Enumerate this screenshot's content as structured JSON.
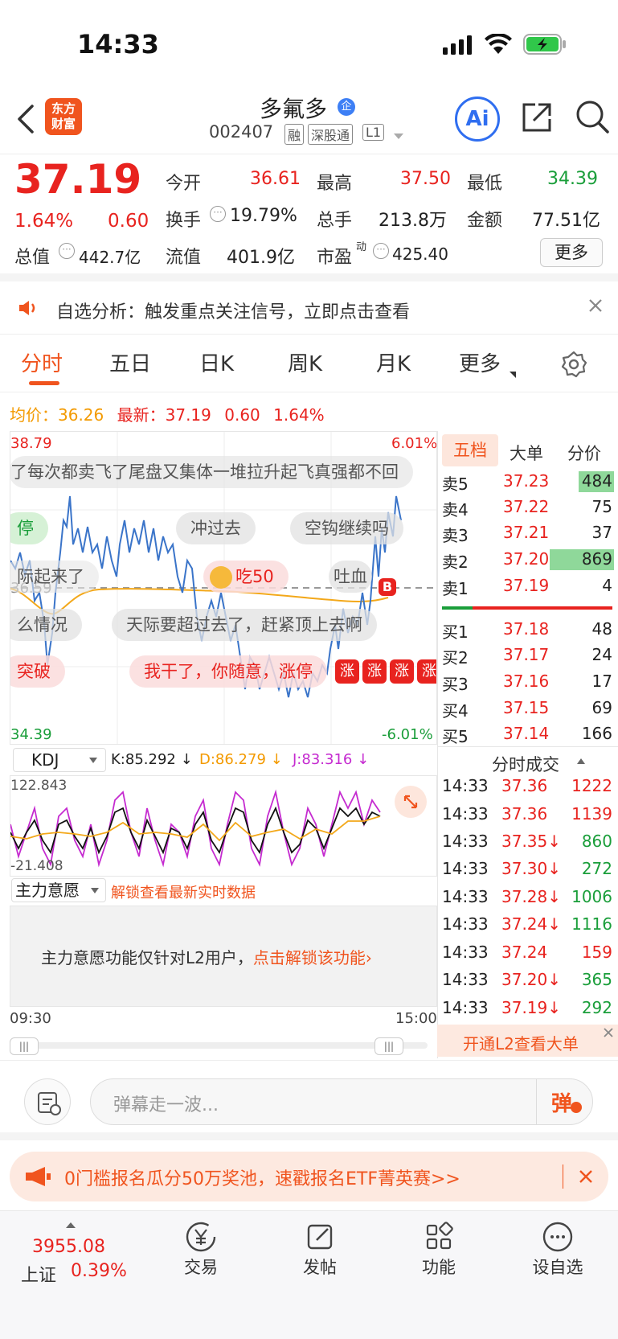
{
  "status_bar": {
    "time": "14:33"
  },
  "header": {
    "app_logo": "东方财富",
    "stock_name": "多氟多",
    "enterprise_badge": "企",
    "stock_code": "002407",
    "tags": [
      "融",
      "深股通",
      "L1"
    ],
    "ai_label": "Ai"
  },
  "quote": {
    "price": "37.19",
    "change_pct": "1.64%",
    "change": "0.60",
    "open_label": "今开",
    "open": "36.61",
    "high_label": "最高",
    "high": "37.50",
    "low_label": "最低",
    "low": "34.39",
    "turnover_label": "换手",
    "turnover": "19.79%",
    "volume_label": "总手",
    "volume": "213.8万",
    "amount_label": "金额",
    "amount": "77.51亿",
    "mktcap_label": "总值",
    "mktcap": "442.7亿",
    "float_label": "流值",
    "float": "401.9亿",
    "pe_label": "市盈",
    "pe_sup": "动",
    "pe": "425.40",
    "more_label": "更多"
  },
  "notice": {
    "text": "自选分析：触发重点关注信号，立即点击查看"
  },
  "chart_tabs": [
    "分时",
    "五日",
    "日K",
    "周K",
    "月K",
    "更多"
  ],
  "avg_line": {
    "avg_label": "均价：",
    "avg": "36.26",
    "latest_label": "最新：",
    "latest": "37.19",
    "latest_change": "0.60",
    "latest_pct": "1.64%"
  },
  "chart_axes": {
    "top_price": "38.79",
    "top_pct": "6.01%",
    "mid_price": "36.59",
    "bottom_price": "34.39",
    "bottom_pct": "-6.01%",
    "time_start": "09:30",
    "time_end": "15:00"
  },
  "danmu": {
    "d1": "了每次都卖飞了尾盘又集体一堆拉升起飞真强都不回",
    "d2": "停",
    "d3": "冲过去",
    "d4": "空钩继续吗",
    "d5": "际起来了",
    "d6": "吃50",
    "d7": "吐血",
    "d8": "么情况",
    "d9": "天际要超过去了，赶紧顶上去啊",
    "d10": "突破",
    "d11": "我干了，你随意，涨停",
    "d12": "涨",
    "b_marker": "B"
  },
  "kdj": {
    "label": "KDJ",
    "k": "K:85.292 ↓",
    "d": "D:86.279 ↓",
    "j": "J:83.316 ↓",
    "max": "122.843",
    "min": "-21.408"
  },
  "main_force": {
    "label": "主力意愿",
    "unlock_link": "解锁查看最新实时数据",
    "info_text": "主力意愿功能仅针对L2用户，",
    "info_link": "点击解锁该功能›"
  },
  "orderbook": {
    "tabs": [
      "五档",
      "大单",
      "分价"
    ],
    "asks": [
      {
        "label": "卖5",
        "price": "37.23",
        "vol": "484"
      },
      {
        "label": "卖4",
        "price": "37.22",
        "vol": "75"
      },
      {
        "label": "卖3",
        "price": "37.21",
        "vol": "37"
      },
      {
        "label": "卖2",
        "price": "37.20",
        "vol": "869"
      },
      {
        "label": "卖1",
        "price": "37.19",
        "vol": "4"
      }
    ],
    "bids": [
      {
        "label": "买1",
        "price": "37.18",
        "vol": "48"
      },
      {
        "label": "买2",
        "price": "37.17",
        "vol": "24"
      },
      {
        "label": "买3",
        "price": "37.16",
        "vol": "17"
      },
      {
        "label": "买4",
        "price": "37.15",
        "vol": "69"
      },
      {
        "label": "买5",
        "price": "37.14",
        "vol": "166"
      }
    ]
  },
  "trades": {
    "title": "分时成交",
    "rows": [
      {
        "time": "14:33",
        "price": "37.36",
        "vol": "1222"
      },
      {
        "time": "14:33",
        "price": "37.36",
        "vol": "1139"
      },
      {
        "time": "14:33",
        "price": "37.35↓",
        "vol": "860"
      },
      {
        "time": "14:33",
        "price": "37.30↓",
        "vol": "272"
      },
      {
        "time": "14:33",
        "price": "37.28↓",
        "vol": "1006"
      },
      {
        "time": "14:33",
        "price": "37.24↓",
        "vol": "1116"
      },
      {
        "time": "14:33",
        "price": "37.24",
        "vol": "159"
      },
      {
        "time": "14:33",
        "price": "37.20↓",
        "vol": "365"
      },
      {
        "time": "14:33",
        "price": "37.19↓",
        "vol": "292"
      }
    ],
    "l2_link": "开通L2查看大单"
  },
  "comment": {
    "placeholder": "弹幕走一波...",
    "send_label": "弹"
  },
  "promo": {
    "text": "0门槛报名瓜分50万奖池，速戳报名ETF菁英赛>>"
  },
  "bottom_nav": {
    "index_value": "3955.08",
    "index_name": "上证",
    "index_pct": "0.39%",
    "items": [
      "交易",
      "发帖",
      "功能",
      "设自选"
    ]
  }
}
